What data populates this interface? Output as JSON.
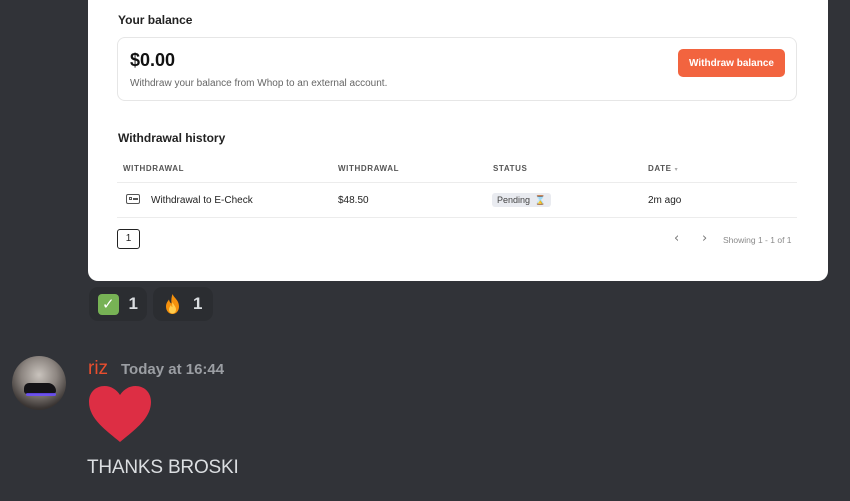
{
  "card": {
    "balance_heading": "Your balance",
    "balance_amount": "$0.00",
    "balance_description": "Withdraw your balance from Whop to an external account.",
    "withdraw_button": "Withdraw balance",
    "history_heading": "Withdrawal history",
    "columns": [
      "WITHDRAWAL",
      "WITHDRAWAL",
      "STATUS",
      "DATE"
    ],
    "rows": [
      {
        "withdrawal": "Withdrawal to E-Check",
        "amount": "$48.50",
        "status": "Pending",
        "date": "2m ago"
      }
    ],
    "pagination": {
      "current_page": "1",
      "summary": "Showing 1 - 1 of 1"
    },
    "accent_color": "#f2643f"
  },
  "reactions": [
    {
      "emoji": "white-check-mark",
      "count": "1"
    },
    {
      "emoji": "fire",
      "count": "1"
    }
  ],
  "message": {
    "username": "riz",
    "timestamp": "Today at 16:44",
    "emoji": "heart",
    "text": "THANKS BROSKI",
    "username_color": "#e94e2e"
  }
}
